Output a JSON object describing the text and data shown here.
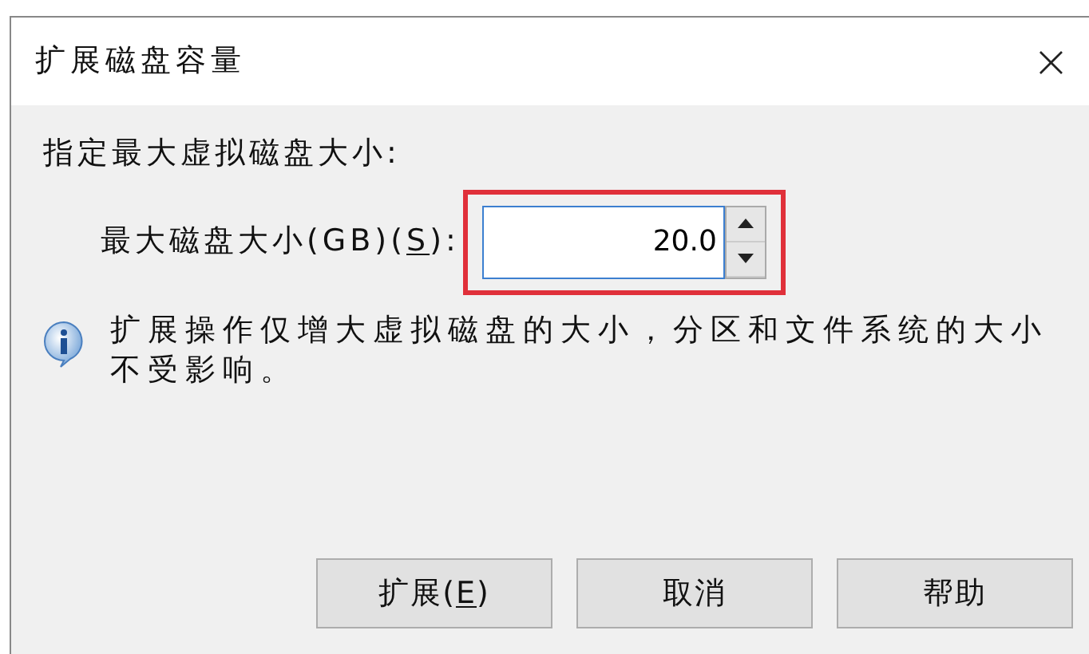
{
  "window": {
    "title": "扩展磁盘容量",
    "close": "×"
  },
  "heading": "指定最大虚拟磁盘大小:",
  "size_field": {
    "label": {
      "before": "最大磁盘大小(GB)(",
      "key": "S",
      "after": "):"
    },
    "value": "20.0",
    "highlighted": true
  },
  "info": "扩展操作仅增大虚拟磁盘的大小，分区和文件系统的大小不受影响。",
  "buttons": [
    {
      "label": {
        "before": "扩展(",
        "key": "E",
        "after": ")"
      }
    },
    {
      "label": {
        "before": "取消"
      }
    },
    {
      "label": {
        "before": "帮助"
      }
    }
  ]
}
